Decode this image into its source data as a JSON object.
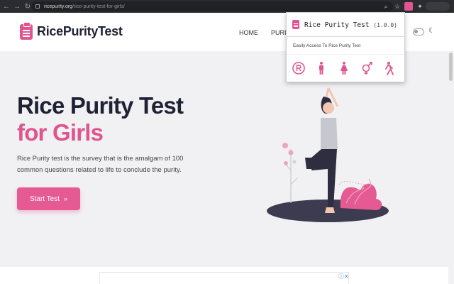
{
  "browser": {
    "url_domain": "ricepurity.org",
    "url_path": "/rice-purity-test-for-girls/"
  },
  "site": {
    "logo_text": "RicePurityTest",
    "nav": {
      "home": "HOME",
      "purity": "PURIT"
    }
  },
  "hero": {
    "title_line1": "Rice Purity Test",
    "title_line2": "for Girls",
    "description": "Rice Purity test is the survey that is the amalgam of 100 common questions related to life to conclude the purity.",
    "button_label": "Start Test"
  },
  "extension_popup": {
    "title": "Rice Purity Test",
    "version": "(1.0.0)",
    "description": "Easily Access To Rice Purity Test",
    "icons": [
      "registered-icon",
      "male-icon",
      "female-icon",
      "gender-icon",
      "person-walking-icon"
    ]
  },
  "colors": {
    "accent": "#e0558f",
    "dark_text": "#1f2233"
  }
}
